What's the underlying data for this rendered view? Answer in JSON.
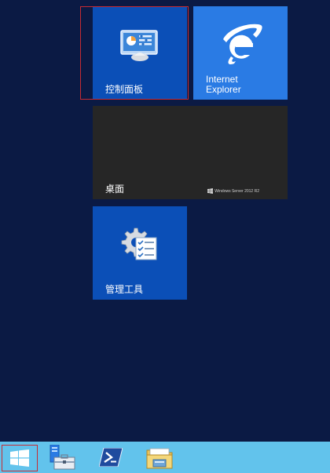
{
  "tiles": {
    "control_panel": {
      "label": "控制面板"
    },
    "internet_explorer": {
      "label": "Internet\nExplorer"
    },
    "desktop": {
      "label": "桌面",
      "brand": "Windows Server 2012 R2"
    },
    "admin_tools": {
      "label": "管理工具"
    }
  },
  "taskbar": {
    "start": "start-button",
    "items": [
      "server-manager",
      "powershell",
      "file-explorer"
    ]
  },
  "colors": {
    "background": "#0b1a44",
    "tile_blue": "#0b4fb7",
    "ie_blue": "#2a7be4",
    "desktop_tile": "#262626",
    "taskbar": "#62c3ec",
    "selection": "#c72b33"
  }
}
